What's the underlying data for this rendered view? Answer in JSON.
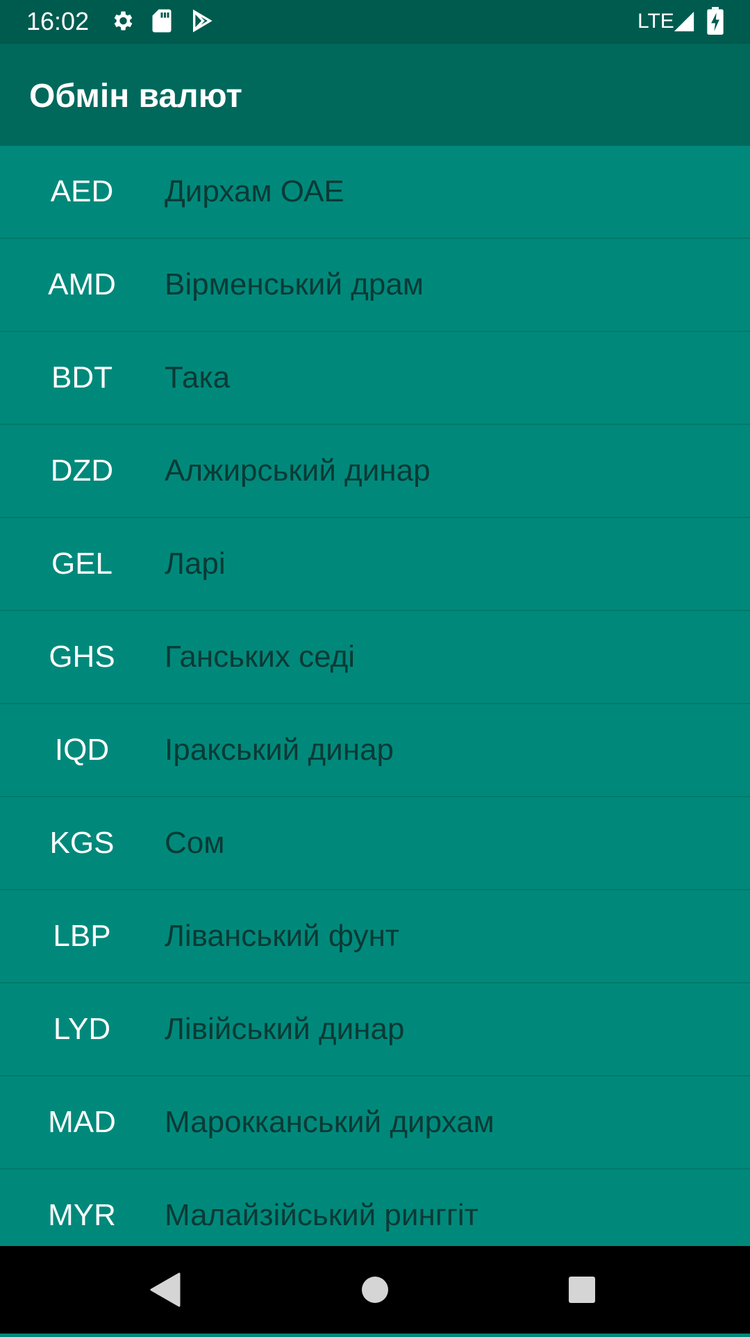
{
  "status_bar": {
    "time": "16:02",
    "network": "LTE",
    "icons": [
      "gear-icon",
      "sd-card-icon",
      "play-store-icon",
      "signal-icon",
      "battery-charging-icon"
    ]
  },
  "app_bar": {
    "title": "Обмін валют"
  },
  "currencies": [
    {
      "code": "AED",
      "name": "Дирхам ОАЕ"
    },
    {
      "code": "AMD",
      "name": "Вірменський драм"
    },
    {
      "code": "BDT",
      "name": "Така"
    },
    {
      "code": "DZD",
      "name": "Алжирський динар"
    },
    {
      "code": "GEL",
      "name": "Ларі"
    },
    {
      "code": "GHS",
      "name": "Ганських седі"
    },
    {
      "code": "IQD",
      "name": "Іракський динар"
    },
    {
      "code": "KGS",
      "name": "Сом"
    },
    {
      "code": "LBP",
      "name": "Ліванський фунт"
    },
    {
      "code": "LYD",
      "name": "Лівійський динар"
    },
    {
      "code": "MAD",
      "name": "Марокканський дирхам"
    },
    {
      "code": "MYR",
      "name": "Малайзійський ринггіт"
    }
  ],
  "nav_bar": {
    "icons": [
      "back-icon",
      "home-icon",
      "recents-icon"
    ]
  },
  "colors": {
    "status_bar": "#005b4f",
    "app_bar": "#00695c",
    "list_background": "#00897b",
    "divider": "#00796b",
    "code_text": "#ffffff",
    "name_text": "#0a3a35"
  }
}
